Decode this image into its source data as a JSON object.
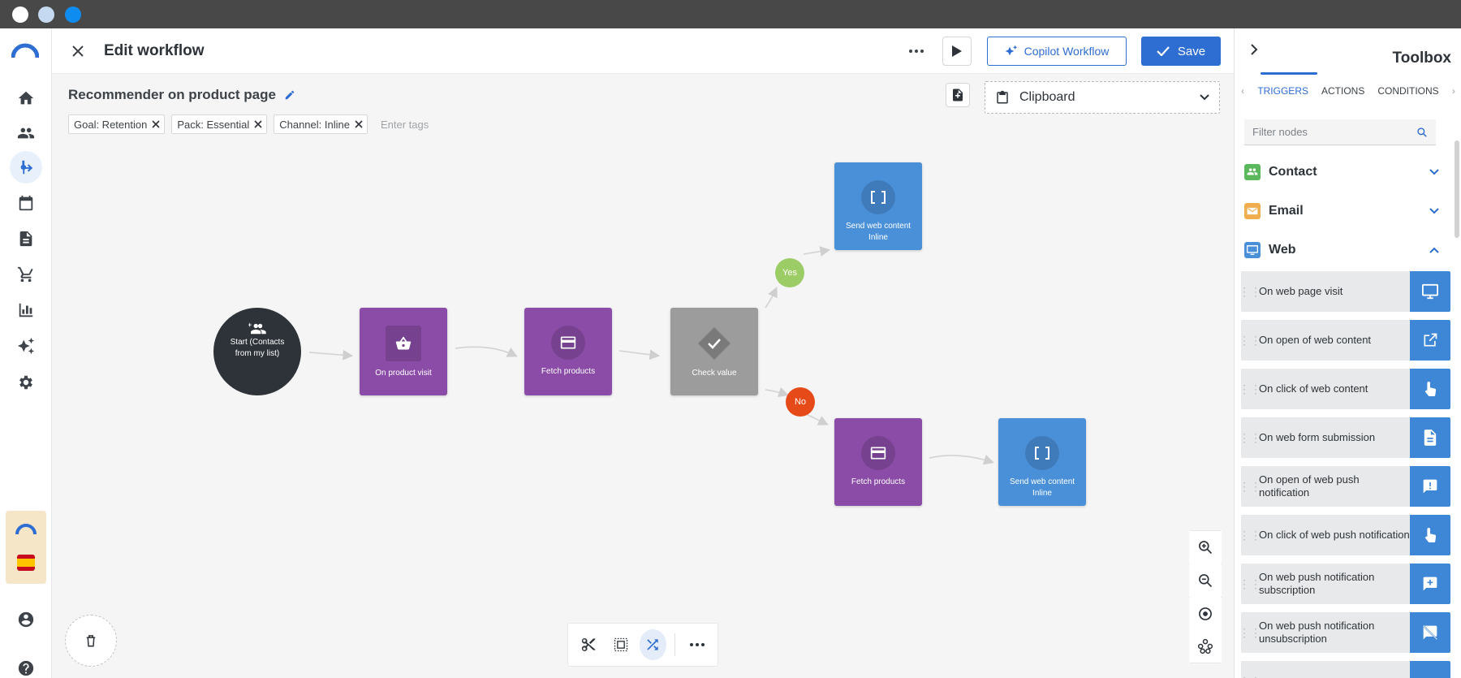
{
  "header": {
    "title": "Edit workflow",
    "copilot_label": "Copilot Workflow",
    "save_label": "Save"
  },
  "workflow": {
    "name": "Recommender on product page",
    "tags": [
      "Goal: Retention",
      "Pack: Essential",
      "Channel: Inline"
    ],
    "tag_placeholder": "Enter tags",
    "clipboard_label": "Clipboard"
  },
  "nodes": {
    "start": "Start (Contacts from my list)",
    "product_visit": "On product visit",
    "fetch_1": "Fetch products",
    "check": "Check value",
    "send_1": "Send web content Inline",
    "fetch_2": "Fetch products",
    "send_2": "Send web content Inline",
    "yes": "Yes",
    "no": "No"
  },
  "toolbox": {
    "title": "Toolbox",
    "tabs": [
      "TRIGGERS",
      "ACTIONS",
      "CONDITIONS"
    ],
    "active_tab": "TRIGGERS",
    "filter_placeholder": "Filter nodes",
    "categories": [
      {
        "label": "Contact",
        "color": "#5cb85c",
        "expanded": false
      },
      {
        "label": "Email",
        "color": "#f0ad4e",
        "expanded": false
      },
      {
        "label": "Web",
        "color": "#4a90d9",
        "expanded": true
      }
    ],
    "items": [
      {
        "label": "On web page visit",
        "icon": "monitor-icon"
      },
      {
        "label": "On open of web content",
        "icon": "open-external-icon"
      },
      {
        "label": "On click of web content",
        "icon": "pointer-hand-icon"
      },
      {
        "label": "On web form submission",
        "icon": "document-icon"
      },
      {
        "label": "On open of web push notification",
        "icon": "message-alert-icon"
      },
      {
        "label": "On click of web push notification",
        "icon": "pointer-hand-icon"
      },
      {
        "label": "On web push notification subscription",
        "icon": "message-add-icon"
      },
      {
        "label": "On web push notification unsubscription",
        "icon": "message-off-icon"
      }
    ]
  },
  "colors": {
    "accent": "#2e6dd1",
    "purple_node": "#8a4ca6",
    "blue_node": "#4a90d9",
    "grey_node": "#9c9c9c",
    "yes": "#9ccc65",
    "no": "#e64a19"
  }
}
